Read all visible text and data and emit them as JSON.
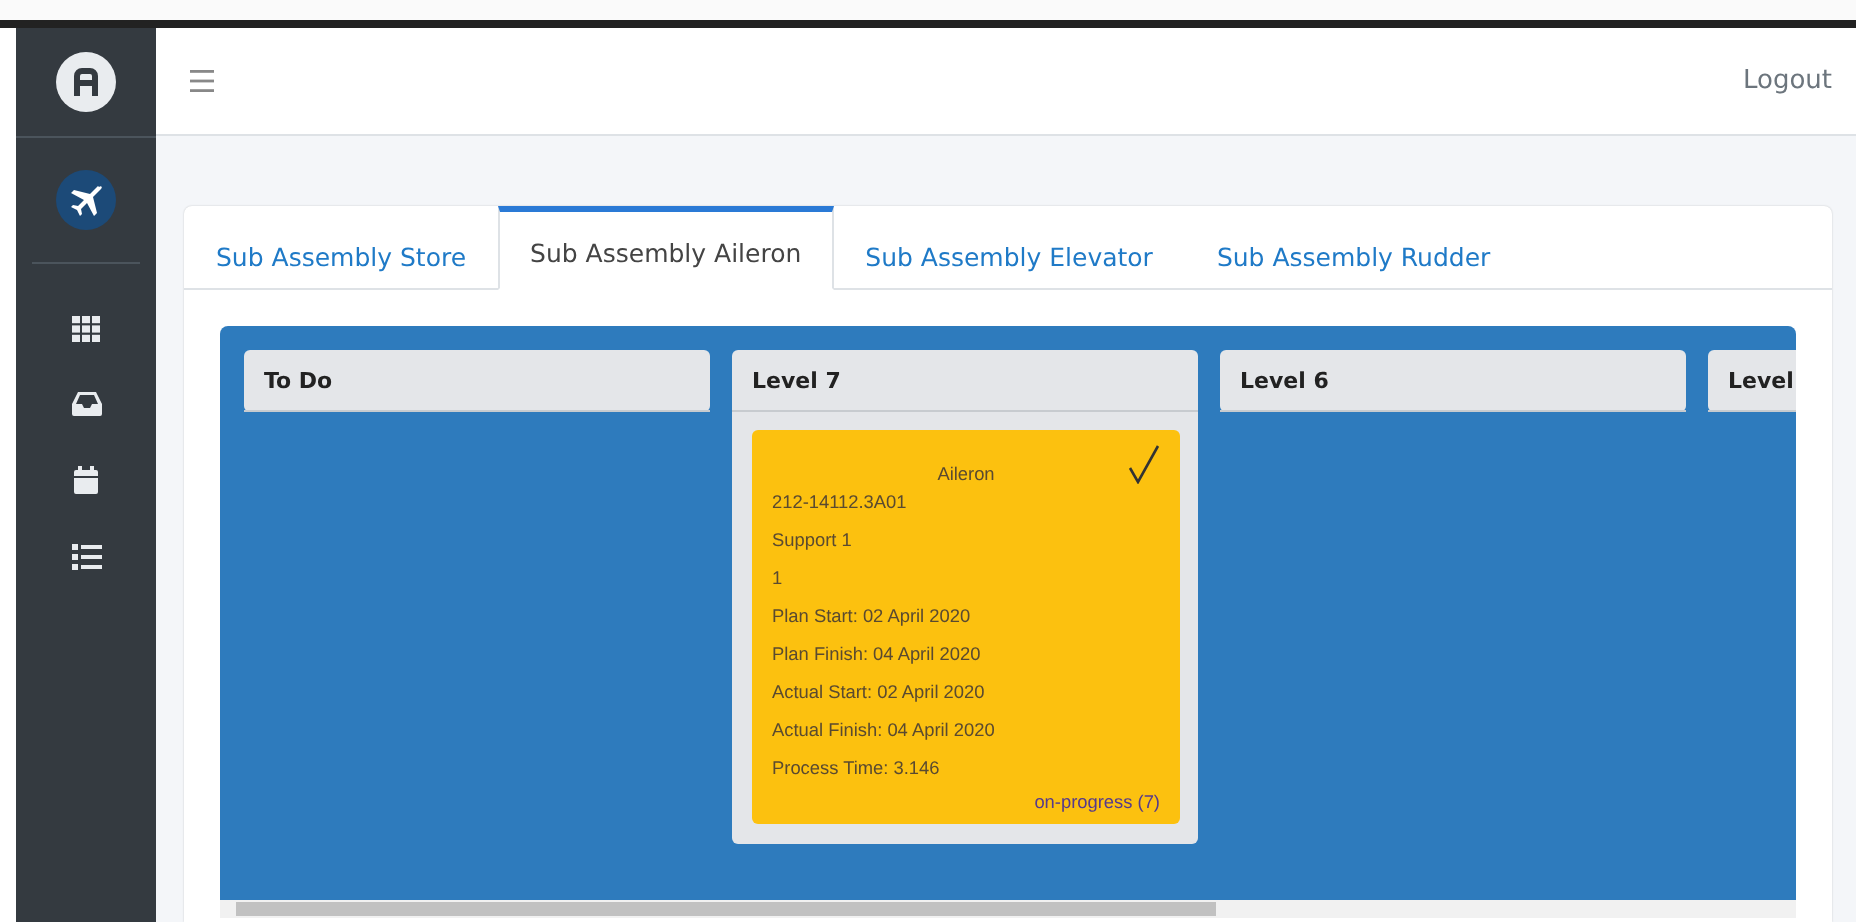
{
  "sidebar": {
    "items": [
      {
        "kind": "grid"
      },
      {
        "kind": "inbox"
      },
      {
        "kind": "calendar"
      },
      {
        "kind": "list"
      }
    ]
  },
  "header": {
    "logout": "Logout"
  },
  "tabs": [
    {
      "label": "Sub Assembly Store",
      "selected": false
    },
    {
      "label": "Sub Assembly Aileron",
      "selected": true
    },
    {
      "label": "Sub Assembly Elevator",
      "selected": false
    },
    {
      "label": "Sub Assembly Rudder",
      "selected": false
    }
  ],
  "columns": [
    {
      "title": "To Do"
    },
    {
      "title": "Level 7",
      "cards": [
        {
          "title": "Aileron",
          "done": true,
          "lines": [
            "212-14112.3A01",
            "Support 1",
            "1",
            "Plan Start: 02 April 2020",
            "Plan Finish: 04 April 2020",
            "Actual Start: 02 April 2020",
            "Actual Finish: 04 April 2020",
            "Process Time: 3.146"
          ],
          "status": "on-progress (7)"
        }
      ]
    },
    {
      "title": "Level 6"
    },
    {
      "title": "Level"
    }
  ]
}
